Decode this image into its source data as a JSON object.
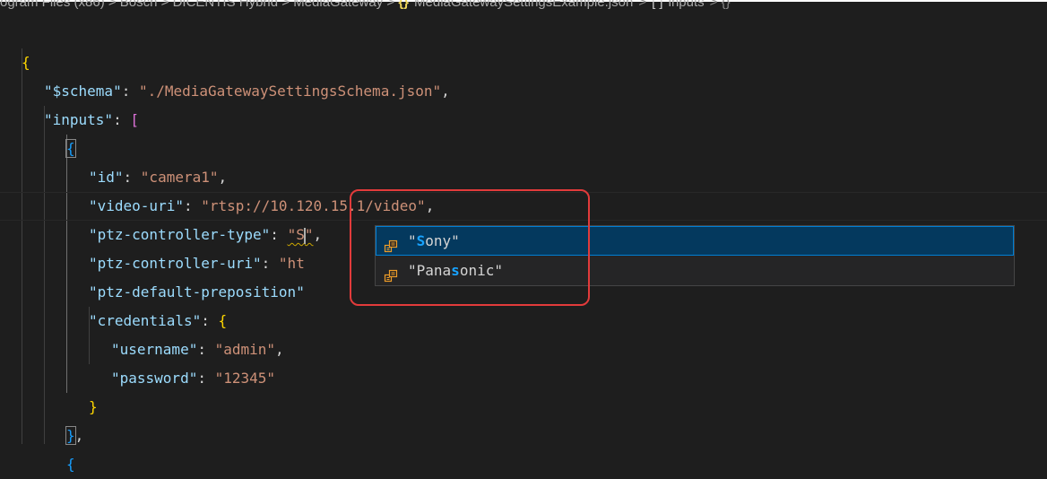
{
  "breadcrumb": {
    "path": "ogram Files (x86) > Bosch > DICENTIS Hybrid > MediaGateway >",
    "file_icon": "{}",
    "file_name": "MediaGatewaySettingsExample.json",
    "sep": ">",
    "node_icon": "[ ]",
    "node_name": "inputs",
    "tail": "> {}"
  },
  "code": {
    "open_root": "{",
    "schema_key": "\"$schema\"",
    "schema_val": "\"./MediaGatewaySettingsSchema.json\"",
    "inputs_key": "\"inputs\"",
    "open_arr": "[",
    "open_obj": "{",
    "id_key": "\"id\"",
    "id_val": "\"camera1\"",
    "video_key": "\"video-uri\"",
    "video_val": "\"rtsp://10.120.15.1/video\"",
    "ptz_type_key": "\"ptz-controller-type\"",
    "ptz_type_val_a": "\"S",
    "ptz_type_val_b": "\"",
    "ptz_uri_key": "\"ptz-controller-uri\"",
    "ptz_uri_val": "\"ht",
    "ptz_preset_key": "\"ptz-default-preposition",
    "ptz_preset_tail": "\"",
    "cred_key": "\"credentials\"",
    "cred_open": "{",
    "user_key": "\"username\"",
    "user_val": "\"admin\"",
    "pass_key": "\"password\"",
    "pass_val": "\"12345\"",
    "cred_close": "}",
    "obj_close": "}",
    "obj_open2": "{",
    "colon": ": ",
    "comma": ","
  },
  "suggestions": [
    {
      "icon": "enum-member-icon",
      "prefix": "\"",
      "match": "S",
      "rest": "ony\"",
      "selected": true
    },
    {
      "icon": "enum-member-icon",
      "prefix": "\"Pana",
      "match": "s",
      "rest": "onic\"",
      "selected": false
    }
  ],
  "colors": {
    "background": "#1e1e1e",
    "key": "#9cdcfe",
    "string": "#ce9178",
    "highlight_box": "#e23b3b",
    "suggest_selected": "#04395e",
    "match": "#18a3ff"
  }
}
